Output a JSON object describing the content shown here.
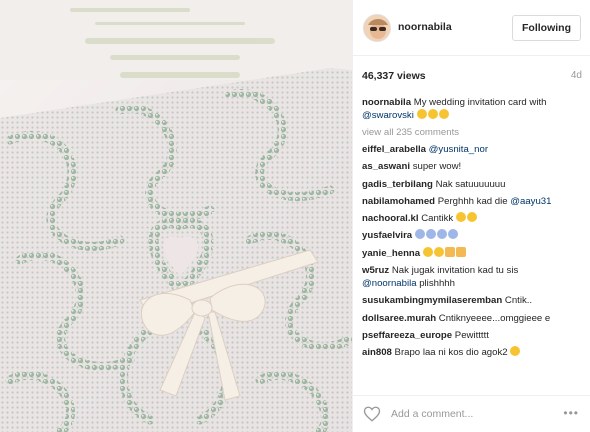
{
  "post": {
    "username": "noornabila",
    "follow_label": "Following",
    "views": "46,337 views",
    "age": "4d"
  },
  "caption": {
    "user": "noornabila",
    "text": "My wedding invitation card with",
    "mention": "@swarovski"
  },
  "view_all": "view all 235 comments",
  "comments": [
    {
      "user": "eiffel_arabella",
      "mention": "@yusnita_nor",
      "text": "",
      "emoji": ""
    },
    {
      "user": "as_aswani",
      "mention": "",
      "text": "super wow!",
      "emoji": ""
    },
    {
      "user": "gadis_terbilang",
      "mention": "",
      "text": "Nak satuuuuuuu",
      "emoji": ""
    },
    {
      "user": "nabilamohamed",
      "mention": "@aayu31",
      "text": "Perghhh kad die",
      "emoji": ""
    },
    {
      "user": "nachooral.kl",
      "mention": "",
      "text": "Cantikk",
      "emoji": "heart-eyes x2"
    },
    {
      "user": "yusfaelvira",
      "mention": "",
      "text": "",
      "emoji": "scream x4"
    },
    {
      "user": "yanie_henna",
      "mention": "",
      "text": "",
      "emoji": "mixed"
    },
    {
      "user": "w5ruz",
      "mention": "@noornabila",
      "text": "Nak jugak invitation kad tu sis",
      "text2": "plishhhh",
      "emoji": ""
    },
    {
      "user": "susukambingmymilaseremban",
      "mention": "",
      "text": "Cntik..",
      "emoji": ""
    },
    {
      "user": "dollsaree.murah",
      "mention": "",
      "text": "Cntiknyeeee...omggieee e",
      "emoji": ""
    },
    {
      "user": "pseffareeza_europe",
      "mention": "",
      "text": "Pewittttt",
      "emoji": ""
    },
    {
      "user": "ain808",
      "mention": "",
      "text": "Brapo laa ni kos dio agok2",
      "emoji": "thinking"
    }
  ],
  "footer": {
    "placeholder": "Add a comment...",
    "more": "•••"
  },
  "colors": {
    "mention": "#003569",
    "muted": "#999999",
    "border": "#efefef"
  }
}
